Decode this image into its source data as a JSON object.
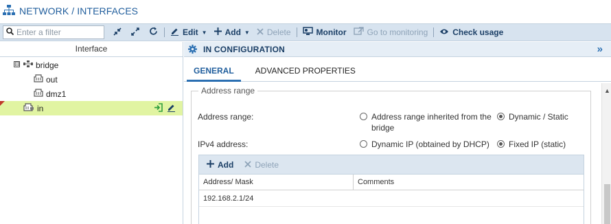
{
  "window": {
    "title": "NETWORK / INTERFACES",
    "title_icon": "network-icon"
  },
  "toolbar": {
    "filter_placeholder": "Enter a filter",
    "edit_label": "Edit",
    "add_label": "Add",
    "delete_label": "Delete",
    "monitor_label": "Monitor",
    "goto_monitoring_label": "Go to monitoring",
    "check_usage_label": "Check usage"
  },
  "tree": {
    "header": "Interface",
    "items": [
      {
        "label": "bridge",
        "toggle": "⊟",
        "icon": "bridge-icon",
        "level": 0
      },
      {
        "label": "out",
        "icon": "ethernet-port-icon",
        "level": 1
      },
      {
        "label": "dmz1",
        "icon": "ethernet-port-icon",
        "level": 1
      },
      {
        "label": "in",
        "icon": "ethernet-port-shield-icon",
        "level": 1,
        "selected": true
      }
    ]
  },
  "panel": {
    "title": "IN CONFIGURATION",
    "expand_glyph": "»",
    "tabs": [
      {
        "label": "GENERAL",
        "active": true
      },
      {
        "label": "ADVANCED PROPERTIES",
        "active": false
      }
    ]
  },
  "address_range": {
    "legend": "Address range",
    "range_label": "Address range:",
    "range_opt1_line1": "Address range inherited from the",
    "range_opt1_line2": "bridge",
    "range_opt2": "Dynamic / Static",
    "range_selected": 2,
    "ipv4_label": "IPv4 address:",
    "ipv4_opt1": "Dynamic IP (obtained by DHCP)",
    "ipv4_opt2": "Fixed IP (static)",
    "ipv4_selected": 2
  },
  "address_grid": {
    "add_label": "Add",
    "delete_label": "Delete",
    "columns": [
      "Address/ Mask",
      "Comments"
    ],
    "rows": [
      [
        "192.168.2.1/24",
        ""
      ]
    ]
  },
  "colors": {
    "accent": "#1f5d9c",
    "toolbar_bg": "#d7e3ef",
    "selected_row": "#e1f4a2",
    "action_green": "#2e9e3e"
  }
}
